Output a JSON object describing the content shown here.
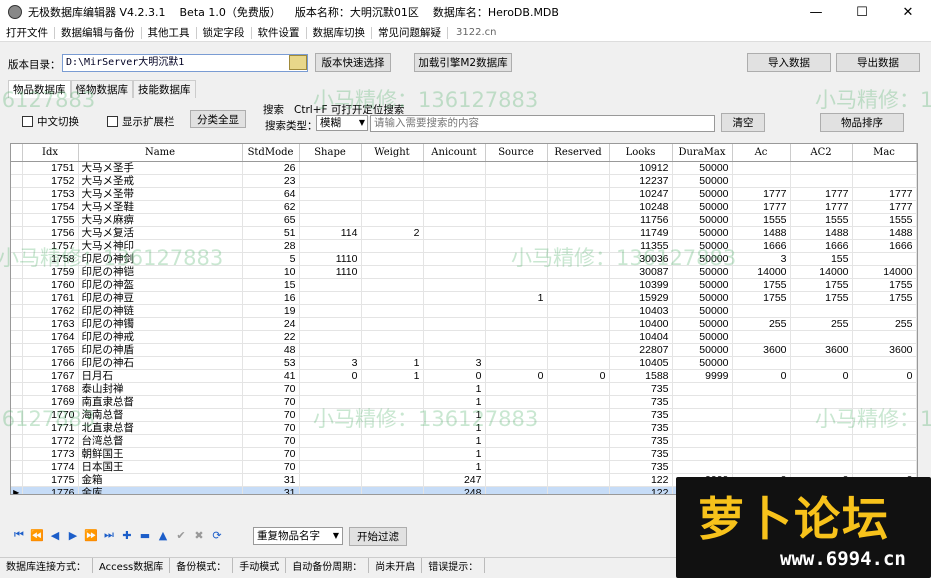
{
  "titlebar": {
    "app": "无极数据库编辑器 V4.2.3.1",
    "edition": "Beta 1.0（免费版）",
    "version_label": "版本名称：大明沉默01区",
    "db_label": "数据库名：HeroDB.MDB"
  },
  "menu": [
    "打开文件",
    "数据编辑与备份",
    "其他工具",
    "锁定字段",
    "软件设置",
    "数据库切换",
    "常见问题解疑"
  ],
  "menu_extra": "3122.cn",
  "version_dir": {
    "label": "版本目录：",
    "value": "D:\\MirServer大明沉默1"
  },
  "buttons": {
    "quick_select": "版本快速选择",
    "load_m2": "加载引擎M2数据库",
    "import": "导入数据",
    "export": "导出数据",
    "category": "分类全显",
    "clear": "清空",
    "sort_items": "物品排序",
    "start_filter": "开始过滤"
  },
  "tabs": [
    "物品数据库",
    "怪物数据库",
    "技能数据库"
  ],
  "options": {
    "chinese": "中文切换",
    "extended": "显示扩展栏"
  },
  "search": {
    "title": "搜索",
    "hint": "Ctrl+F 可打开定位搜索",
    "type_label": "搜索类型：",
    "type_value": "模糊",
    "placeholder": "请输入需要搜索的内容"
  },
  "table": {
    "columns": [
      "Idx",
      "Name",
      "StdMode",
      "Shape",
      "Weight",
      "Anicount",
      "Source",
      "Reserved",
      "Looks",
      "DuraMax",
      "Ac",
      "AC2",
      "Mac"
    ],
    "rows": [
      [
        "1751",
        "大马メ圣手",
        "26",
        "",
        "",
        "",
        "",
        "",
        "10912",
        "50000",
        "",
        "",
        ""
      ],
      [
        "1752",
        "大马メ圣戒",
        "23",
        "",
        "",
        "",
        "",
        "",
        "12237",
        "50000",
        "",
        "",
        ""
      ],
      [
        "1753",
        "大马メ圣带",
        "64",
        "",
        "",
        "",
        "",
        "",
        "10247",
        "50000",
        "1777",
        "1777",
        "1777"
      ],
      [
        "1754",
        "大马メ圣鞋",
        "62",
        "",
        "",
        "",
        "",
        "",
        "10248",
        "50000",
        "1777",
        "1777",
        "1777"
      ],
      [
        "1755",
        "大马メ麻痹",
        "65",
        "",
        "",
        "",
        "",
        "",
        "11756",
        "50000",
        "1555",
        "1555",
        "1555"
      ],
      [
        "1756",
        "大马メ复活",
        "51",
        "114",
        "2",
        "",
        "",
        "",
        "11749",
        "50000",
        "1488",
        "1488",
        "1488"
      ],
      [
        "1757",
        "大马メ神印",
        "28",
        "",
        "",
        "",
        "",
        "",
        "11355",
        "50000",
        "1666",
        "1666",
        "1666"
      ],
      [
        "1758",
        "印尼の神剑",
        "5",
        "1110",
        "",
        "",
        "",
        "",
        "30036",
        "50000",
        "3",
        "155",
        ""
      ],
      [
        "1759",
        "印尼の神铠",
        "10",
        "1110",
        "",
        "",
        "",
        "",
        "30087",
        "50000",
        "14000",
        "14000",
        "14000"
      ],
      [
        "1760",
        "印尼の神盔",
        "15",
        "",
        "",
        "",
        "",
        "",
        "10399",
        "50000",
        "1755",
        "1755",
        "1755"
      ],
      [
        "1761",
        "印尼の神豆",
        "16",
        "",
        "",
        "",
        "1",
        "",
        "15929",
        "50000",
        "1755",
        "1755",
        "1755"
      ],
      [
        "1762",
        "印尼の神链",
        "19",
        "",
        "",
        "",
        "",
        "",
        "10403",
        "50000",
        "",
        "",
        ""
      ],
      [
        "1763",
        "印尼の神镯",
        "24",
        "",
        "",
        "",
        "",
        "",
        "10400",
        "50000",
        "255",
        "255",
        "255"
      ],
      [
        "1764",
        "印尼の神戒",
        "22",
        "",
        "",
        "",
        "",
        "",
        "10404",
        "50000",
        "",
        "",
        ""
      ],
      [
        "1765",
        "印尼の神盾",
        "48",
        "",
        "",
        "",
        "",
        "",
        "22807",
        "50000",
        "3600",
        "3600",
        "3600"
      ],
      [
        "1766",
        "印尼の神石",
        "53",
        "3",
        "1",
        "3",
        "",
        "",
        "10405",
        "50000",
        "",
        "",
        ""
      ],
      [
        "1767",
        "日月石",
        "41",
        "0",
        "1",
        "0",
        "0",
        "0",
        "1588",
        "9999",
        "0",
        "0",
        "0"
      ],
      [
        "1768",
        "泰山封禅",
        "70",
        "",
        "",
        "1",
        "",
        "",
        "735",
        "",
        "",
        "",
        ""
      ],
      [
        "1769",
        "南直隶总督",
        "70",
        "",
        "",
        "1",
        "",
        "",
        "735",
        "",
        "",
        "",
        ""
      ],
      [
        "1770",
        "海南总督",
        "70",
        "",
        "",
        "1",
        "",
        "",
        "735",
        "",
        "",
        "",
        ""
      ],
      [
        "1771",
        "北直隶总督",
        "70",
        "",
        "",
        "1",
        "",
        "",
        "735",
        "",
        "",
        "",
        ""
      ],
      [
        "1772",
        "台湾总督",
        "70",
        "",
        "",
        "1",
        "",
        "",
        "735",
        "",
        "",
        "",
        ""
      ],
      [
        "1773",
        "朝鲜国王",
        "70",
        "",
        "",
        "1",
        "",
        "",
        "735",
        "",
        "",
        "",
        ""
      ],
      [
        "1774",
        "日本国王",
        "70",
        "",
        "",
        "1",
        "",
        "",
        "735",
        "",
        "",
        "",
        ""
      ],
      [
        "1775",
        "金箱",
        "31",
        "",
        "",
        "247",
        "",
        "",
        "122",
        "9999",
        "0",
        "0",
        "0"
      ],
      [
        "1776",
        "金库",
        "31",
        "",
        "",
        "248",
        "",
        "",
        "122",
        "",
        "",
        "",
        ""
      ]
    ],
    "selected_index": 25
  },
  "filter_dropdown": "重复物品名字",
  "statusbar": [
    "数据库连接方式：",
    "Access数据库",
    "备份模式：",
    "手动模式",
    "自动备份周期：",
    "尚未开启",
    "错误提示："
  ],
  "watermark": "小马精修：136127883",
  "logo": {
    "text": "萝卜论坛",
    "url": "www.6994.cn",
    "color": "#f7c21b"
  }
}
